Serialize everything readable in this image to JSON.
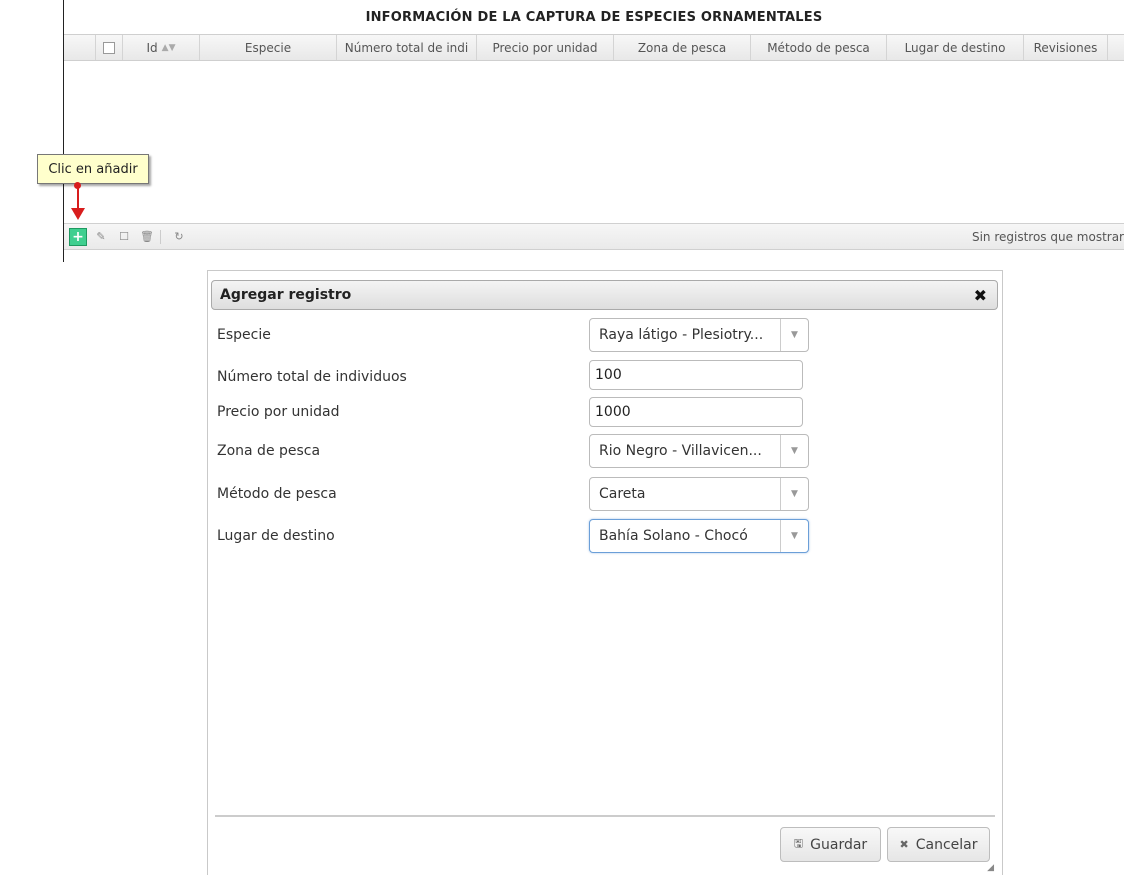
{
  "grid": {
    "title": "INFORMACIÓN DE LA CAPTURA DE ESPECIES ORNAMENTALES",
    "columns": [
      "Id",
      "Especie",
      "Número total de indi",
      "Precio por unidad",
      "Zona de pesca",
      "Método de pesca",
      "Lugar de destino",
      "Revisiones"
    ],
    "sort_icon": "sort-icon",
    "pager_info": "Sin registros que mostrar"
  },
  "tooltip": {
    "text": "Clic en añadir"
  },
  "dialog": {
    "title": "Agregar registro",
    "close_icon": "close-icon",
    "fields": {
      "especie": {
        "label": "Especie",
        "value": "Raya látigo - Plesiotry..."
      },
      "numero": {
        "label": "Número total de individuos",
        "value": "100"
      },
      "precio": {
        "label": "Precio por unidad",
        "value": "1000"
      },
      "zona": {
        "label": "Zona de pesca",
        "value": "Rio Negro - Villavicen..."
      },
      "metodo": {
        "label": "Método de pesca",
        "value": "Careta"
      },
      "lugar": {
        "label": "Lugar de destino",
        "value": "Bahía Solano - Chocó"
      }
    },
    "save_label": "Guardar",
    "cancel_label": "Cancelar"
  },
  "colors": {
    "add_button": "#3fcf8f",
    "annotation_arrow": "#d81d1d",
    "tooltip_bg": "#ffffcc",
    "focus_border": "#6b9fd8"
  }
}
